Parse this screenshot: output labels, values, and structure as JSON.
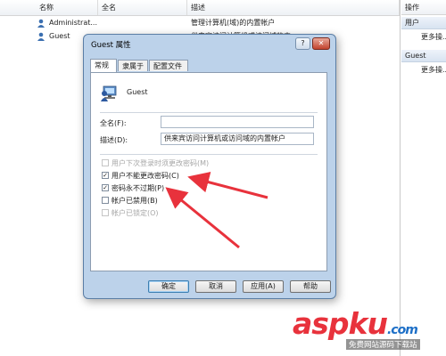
{
  "list": {
    "columns": [
      "名称",
      "全名",
      "描述"
    ],
    "rows": [
      {
        "name": "Administrat...",
        "description": "管理计算机(域)的内置帐户"
      },
      {
        "name": "Guest",
        "description": "供来宾访问计算机或访问域的内"
      }
    ]
  },
  "actions": {
    "title": "操作",
    "sections": [
      {
        "header": "用户",
        "item": "更多操..."
      },
      {
        "header": "Guest",
        "item": "更多操..."
      }
    ]
  },
  "dialog": {
    "title": "Guest 属性",
    "help_glyph": "?",
    "close_glyph": "✕",
    "tabs": [
      "常规",
      "隶属于",
      "配置文件"
    ],
    "username": "Guest",
    "fullname_label": "全名(F):",
    "fullname_value": "",
    "desc_label": "描述(D):",
    "desc_value": "供来宾访问计算机或访问域的内置帐户",
    "options": [
      {
        "label": "用户下次登录时须更改密码(M)",
        "checked": false,
        "disabled": true
      },
      {
        "label": "用户不能更改密码(C)",
        "checked": true,
        "disabled": false
      },
      {
        "label": "密码永不过期(P)",
        "checked": true,
        "disabled": false
      },
      {
        "label": "帐户已禁用(B)",
        "checked": false,
        "disabled": false
      },
      {
        "label": "帐户已锁定(O)",
        "checked": false,
        "disabled": true
      }
    ],
    "buttons": {
      "ok": "确定",
      "cancel": "取消",
      "apply": "应用(A)",
      "help": "帮助"
    }
  },
  "watermark": {
    "brand": "aspku",
    "brand_suffix": ".com",
    "tagline": "免费网站源码下载站"
  },
  "colors": {
    "arrow": "#e8323c",
    "wm_asp": "#e8323c",
    "wm_ku": "#1d6fc7"
  }
}
